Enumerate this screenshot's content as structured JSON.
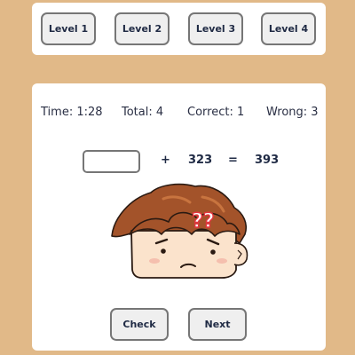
{
  "levels": [
    "Level 1",
    "Level 2",
    "Level 3",
    "Level 4"
  ],
  "stats": {
    "time": "Time: 1:28",
    "total": "Total: 4",
    "correct": "Correct: 1",
    "wrong": "Wrong: 3"
  },
  "equation": {
    "answer_value": "",
    "operator": "+",
    "operand": "323",
    "equals": "=",
    "result": "393"
  },
  "character": {
    "icon": "confused-boy-face-icon",
    "thought_glyphs": "??"
  },
  "actions": {
    "check_label": "Check",
    "next_label": "Next"
  },
  "colors": {
    "background": "#e1b988",
    "panel": "#ffffff",
    "text": "#1f2a44",
    "hair": "#a3532a",
    "skin": "#fbe3cc",
    "question_marks": "#e3353f"
  }
}
